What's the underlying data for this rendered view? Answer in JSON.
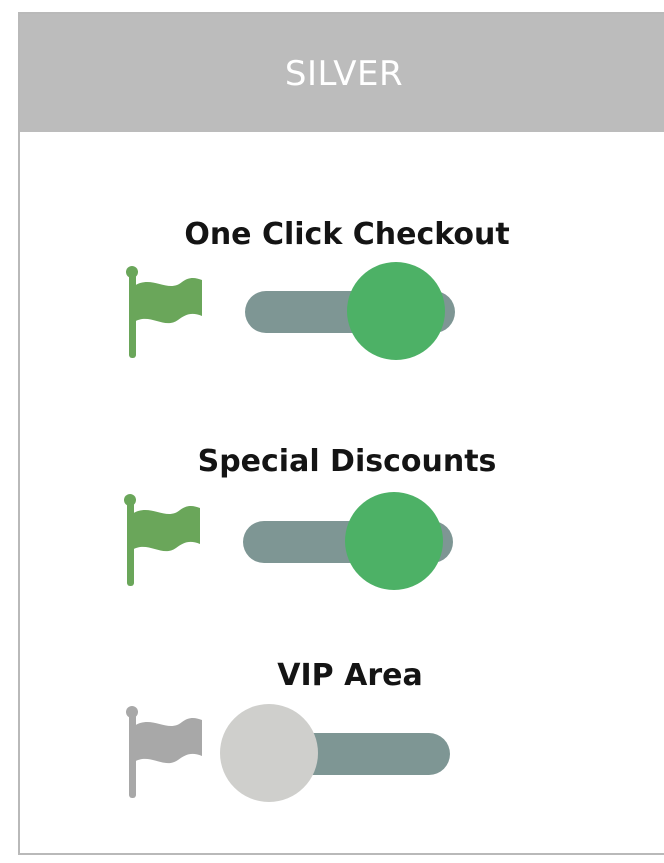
{
  "plan": {
    "title": "SILVER"
  },
  "colors": {
    "header_bg": "#bcbcbc",
    "active_flag": "#6aa65a",
    "inactive_flag": "#a8a8a8",
    "toggle_track": "#7e9694",
    "knob_on": "#4db166",
    "knob_off": "#cfcfcc"
  },
  "features": [
    {
      "label": "One Click Checkout",
      "enabled": true,
      "flag_icon": "flag-icon"
    },
    {
      "label": "Special Discounts",
      "enabled": true,
      "flag_icon": "flag-icon"
    },
    {
      "label": "VIP Area",
      "enabled": false,
      "flag_icon": "flag-icon"
    }
  ]
}
